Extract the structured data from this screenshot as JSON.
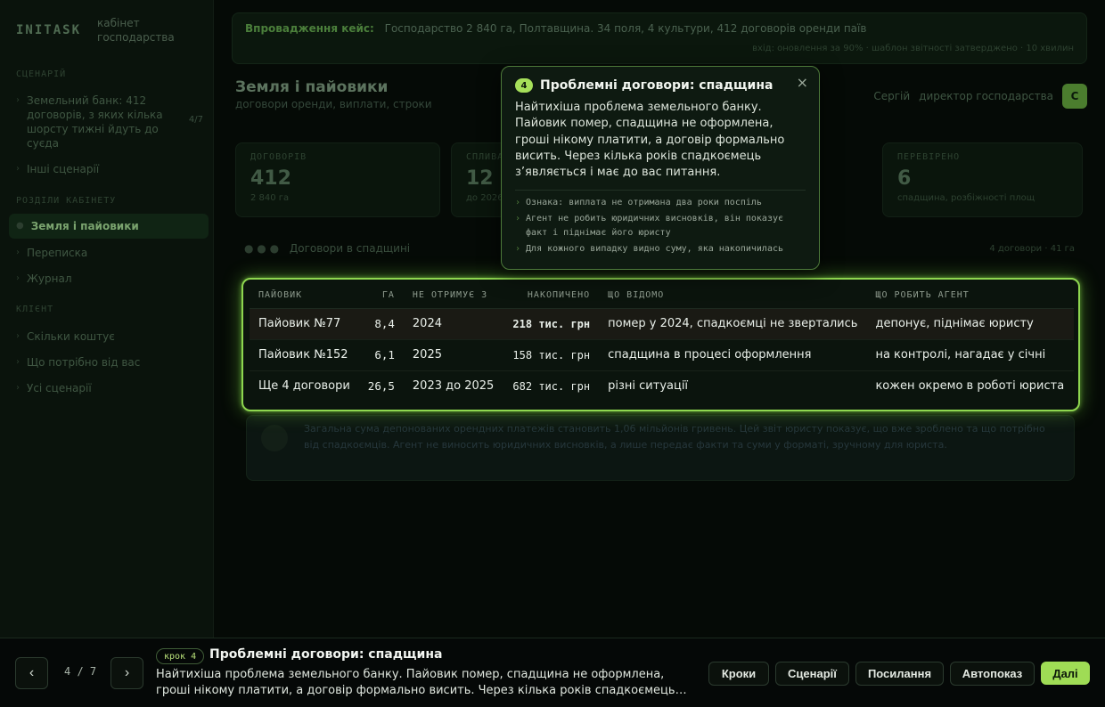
{
  "app": {
    "logo": "INITASK",
    "subtitle": "кабінет господарства"
  },
  "sidebar": {
    "sections": [
      {
        "label": "СЦЕНАРІЙ"
      },
      {
        "label": "РОЗДІЛИ КАБІНЕТУ"
      },
      {
        "label": "КЛІЄНТ"
      }
    ],
    "scenario": {
      "label": "Земельний банк: 412 договорів, з яких кілька шорсту тижні йдуть до суєда",
      "badge": "4/7"
    },
    "other_scenarios": "Інші сценарії",
    "items": [
      {
        "label": "Земля і пайовики"
      },
      {
        "label": "Переписка"
      },
      {
        "label": "Журнал"
      }
    ],
    "client_items": [
      {
        "label": "Скільки коштує"
      },
      {
        "label": "Що потрібно від вас"
      },
      {
        "label": "Усі сценарії"
      }
    ]
  },
  "banner": {
    "label": "Впровадження кейс:",
    "text": "Господарство 2 840 га, Полтавщина. 34 поля, 4 культури, 412 договорів оренди паїв",
    "sub": "вхід: оновлення за 90% · шаблон звітності затверджено · 10 хвилин"
  },
  "page": {
    "title": "Земля і пайовики",
    "subtitle": "договори оренди, виплати, строки",
    "user_name": "Сергій",
    "user_role": "директор господарства",
    "avatar": "С"
  },
  "stats": [
    {
      "label": "ДОГОВОРІВ",
      "value": "412",
      "note": "2 840 га"
    },
    {
      "label": "СПЛИВАЮТЬ",
      "value": "12",
      "note": "до 2026"
    },
    {
      "label": "ПЕРЕВІРЕНО",
      "value": "6",
      "note": "спадщина, розбіжності площ"
    }
  ],
  "crumb": {
    "text": "Договори в спадщині",
    "right": "4 договори · 41 га"
  },
  "note_card": {
    "text": "Загальна сума депонованих орендних платежів становить 1,06 мільйонів гривень. Цей звіт юристу показує, що вже зроблено та що потрібно від спадкоємців. Агент не виносить юридичних висновків, а лише передає факти та суми у форматі, зручному для юриста."
  },
  "table": {
    "headers": {
      "owner": "ПАЙОВИК",
      "ha": "ГА",
      "since": "НЕ ОТРИМУЄ З",
      "accum": "НАКОПИЧЕНО",
      "known": "ЩО ВІДОМО",
      "agent": "ЩО РОБИТЬ АГЕНТ"
    },
    "rows": [
      {
        "owner": "Пайовик №77",
        "ha": "8,4",
        "since": "2024",
        "accum": "218 тис. грн",
        "known": "помер у 2024, спадкоємці не звертались",
        "agent": "депонує, піднімає юристу"
      },
      {
        "owner": "Пайовик №152",
        "ha": "6,1",
        "since": "2025",
        "accum": "158 тис. грн",
        "known": "спадщина в процесі оформлення",
        "agent": "на контролі, нагадає у січні"
      },
      {
        "owner": "Ще 4 договори",
        "ha": "26,5",
        "since": "2023 до 2025",
        "accum": "682 тис. грн",
        "known": "різні ситуації",
        "agent": "кожен окремо в роботі юриста"
      }
    ]
  },
  "popover": {
    "step": "4",
    "title": "Проблемні договори: спадщина",
    "close": "×",
    "text": "Найтихіша проблема земельного банку. Пайовик помер, спадщина не оформлена, гроші нікому платити, а договір формально висить. Через кілька років спадкоємець з’являється і має до вас питання.",
    "bullets": [
      "Ознака: виплата не отримана два роки поспіль",
      "Агент не робить юридичних висновків, він показує факт і піднімає його юристу",
      "Для кожного випадку видно суму, яка накопичилась"
    ]
  },
  "tour": {
    "prev": "‹",
    "next": "›",
    "counter": "4 / 7",
    "step_label": "крок 4",
    "title": "Проблемні договори: спадщина",
    "description": "Найтихіша проблема земельного банку. Пайовик помер, спадщина не оформлена, гроші нікому платити, а договір формально висить. Через кілька років спадкоємець з’являється і…",
    "buttons": {
      "steps": "Кроки",
      "scenarios": "Сценарії",
      "links": "Посилання",
      "autoplay": "Автопоказ",
      "next": "Далі"
    }
  },
  "colors": {
    "accent": "#9fdc55",
    "background": "#050a06",
    "spotlight_border": "#8ed64f"
  }
}
